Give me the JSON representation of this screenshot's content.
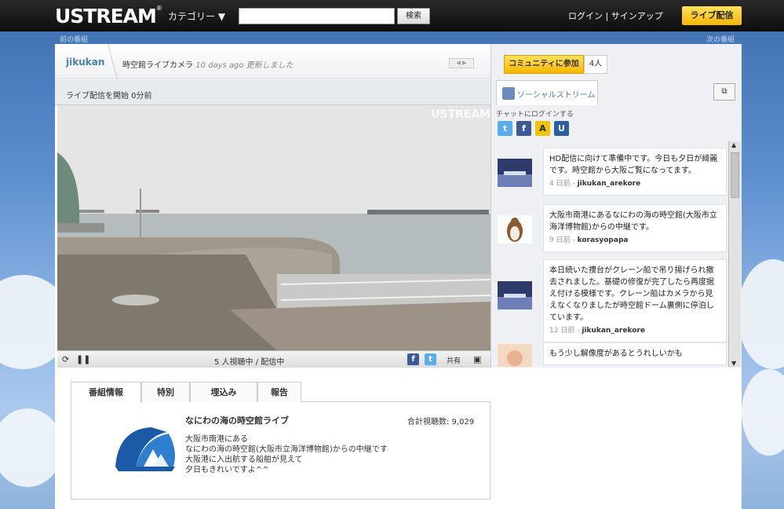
{
  "header": {
    "logo": "USTREAM",
    "category_menu": "カテゴリー ▼",
    "search_placeholder": "",
    "search_button": "検索",
    "login": "ログイン | サインアップ",
    "go_live": "ライブ配信"
  },
  "nav": {
    "prev": "前の番組",
    "next": "次の番組"
  },
  "program": {
    "channel": "jikukan",
    "title": "時空館ライブカメラ",
    "updated_ago": "10 days ago",
    "updated_suffix": "更新しました",
    "live_status": "ライブ配信を開始 0分前"
  },
  "player": {
    "watermark": "USTREAM",
    "viewers": "5 人視聴中 / 配信中",
    "share_label": "共有"
  },
  "tabs": [
    {
      "label": "番組情報"
    },
    {
      "label": "特別"
    },
    {
      "label": "埋込み"
    },
    {
      "label": "報告"
    }
  ],
  "info": {
    "title": "なにわの海の時空館ライブ",
    "total_views": "合計視聴数: 9,029",
    "description": "大阪市南港にある\nなにわの海の時空館(大阪市立海洋博物館)からの中継です\n大阪港に入出航する船舶が見えて\n夕日もきれいですよ^^"
  },
  "community": {
    "join_label": "コミュニティに参加",
    "member_count": "4人"
  },
  "social": {
    "tab_label": "ソーシャルストリーム",
    "chat_login": "チャットにログインする"
  },
  "messages": [
    {
      "text": "HD配信に向けて準備中です。今日も夕日が綺麗です。時空館から大阪ご覧になってます。",
      "time": "4 日前",
      "user": "jikukan_arekore"
    },
    {
      "text": "大阪市南港にあるなにわの海の時空館(大阪市立海洋博物館)からの中継です。",
      "time": "9 日前",
      "user": "korasyopapa"
    },
    {
      "text": "本日続いた捜台がクレーン船で吊り揚げられ撤去されました。基礎の修復が完了したら再度据え付ける模様です。クレーン船はカメラから見えなくなりましたが時空館ドーム裏側に停泊しています。",
      "time": "12 日前",
      "user": "jikukan_arekore"
    },
    {
      "text": "もう少し解像度があるとうれしいかも",
      "time": "",
      "user": ""
    }
  ],
  "colors": {
    "accent_yellow": "#f5b700",
    "link_blue": "#4a80b8",
    "topbar": "#111111"
  }
}
